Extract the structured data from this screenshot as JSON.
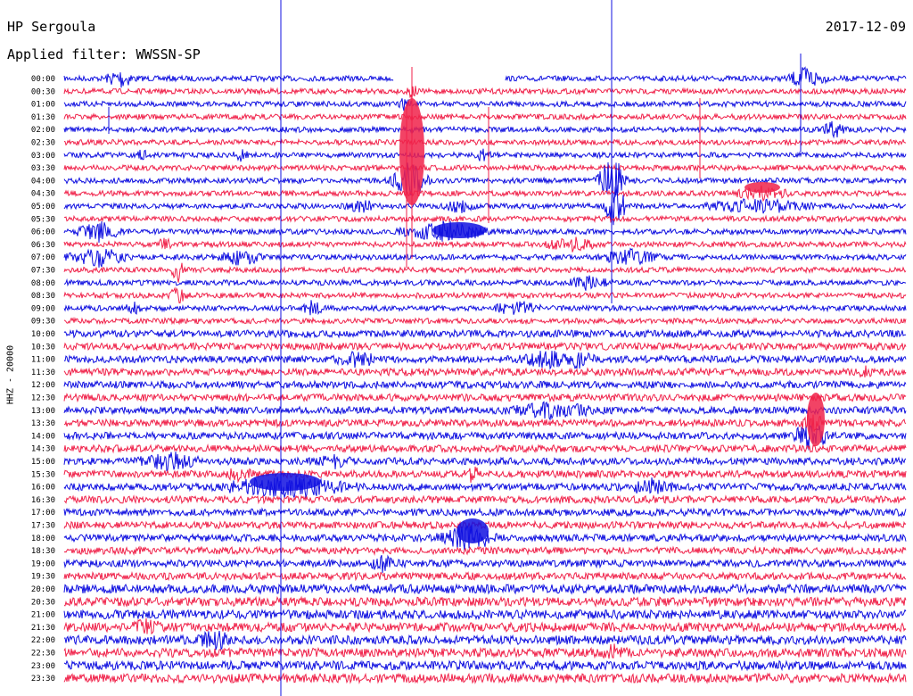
{
  "header": {
    "station": "HP Sergoula",
    "filter": "Applied filter: WWSSN-SP",
    "date": "2017-12-09"
  },
  "colors": {
    "trace_a": "#1010e0",
    "trace_b": "#f0224a",
    "background": "#ffffff"
  },
  "chart_data": {
    "type": "line",
    "title": "HP Sergoula",
    "subtitle": "Applied filter: WWSSN-SP",
    "date": "2017-12-09",
    "ylabel": "HHZ - 20000",
    "row_interval_minutes": 30,
    "color_cycle": [
      "#1010e0",
      "#f0224a"
    ],
    "row_labels": [
      "00:00",
      "00:30",
      "01:00",
      "01:30",
      "02:00",
      "02:30",
      "03:00",
      "03:30",
      "04:00",
      "04:30",
      "05:00",
      "05:30",
      "06:00",
      "06:30",
      "07:00",
      "07:30",
      "08:00",
      "08:30",
      "09:00",
      "09:30",
      "10:00",
      "10:30",
      "11:00",
      "11:30",
      "12:00",
      "12:30",
      "13:00",
      "13:30",
      "14:00",
      "14:30",
      "15:00",
      "15:30",
      "16:00",
      "16:30",
      "17:00",
      "17:30",
      "18:00",
      "18:30",
      "19:00",
      "19:30",
      "20:00",
      "20:30",
      "21:00",
      "21:30",
      "22:00",
      "22:30",
      "23:00",
      "23:30"
    ],
    "noise_amplitude": [
      3,
      3,
      3,
      3,
      3,
      3,
      3,
      3,
      3,
      3,
      3,
      3,
      3,
      3,
      3,
      3,
      3,
      3,
      3,
      3,
      4,
      4,
      4,
      4,
      4,
      4,
      4,
      4,
      4,
      4,
      4,
      4,
      4,
      4,
      4,
      4,
      4,
      4,
      4,
      4,
      5,
      5,
      5,
      5,
      5,
      5,
      5,
      5
    ],
    "data_gap": {
      "row": "00:00",
      "start_fraction": 0.41,
      "end_fraction": 0.525
    }
  }
}
